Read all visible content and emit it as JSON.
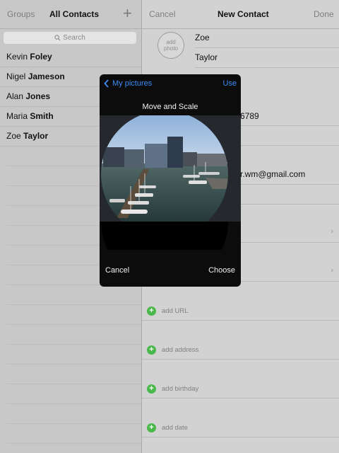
{
  "left_nav": {
    "groups": "Groups",
    "title": "All Contacts",
    "add_symbol": "+"
  },
  "search": {
    "placeholder": "Search"
  },
  "contacts": [
    {
      "first": "Kevin",
      "last": "Foley"
    },
    {
      "first": "Nigel",
      "last": "Jameson"
    },
    {
      "first": "Alan",
      "last": "Jones"
    },
    {
      "first": "Maria",
      "last": "Smith"
    },
    {
      "first": "Zoe",
      "last": "Taylor"
    }
  ],
  "right_nav": {
    "cancel": "Cancel",
    "title": "New Contact",
    "done": "Done"
  },
  "new_contact": {
    "add_photo": "add photo",
    "first_name": "Zoe",
    "last_name": "Taylor",
    "phone_fragment": "6789",
    "email_fragment": "r.wm@gmail.com",
    "add_fields": [
      "add URL",
      "add address",
      "add birthday",
      "add date"
    ]
  },
  "popover": {
    "back_label": "My pictures",
    "use_label": "Use",
    "title": "Move and Scale",
    "cancel_label": "Cancel",
    "choose_label": "Choose"
  },
  "colors": {
    "accent_blue": "#3b8cf5",
    "add_green": "#4ab84a"
  }
}
